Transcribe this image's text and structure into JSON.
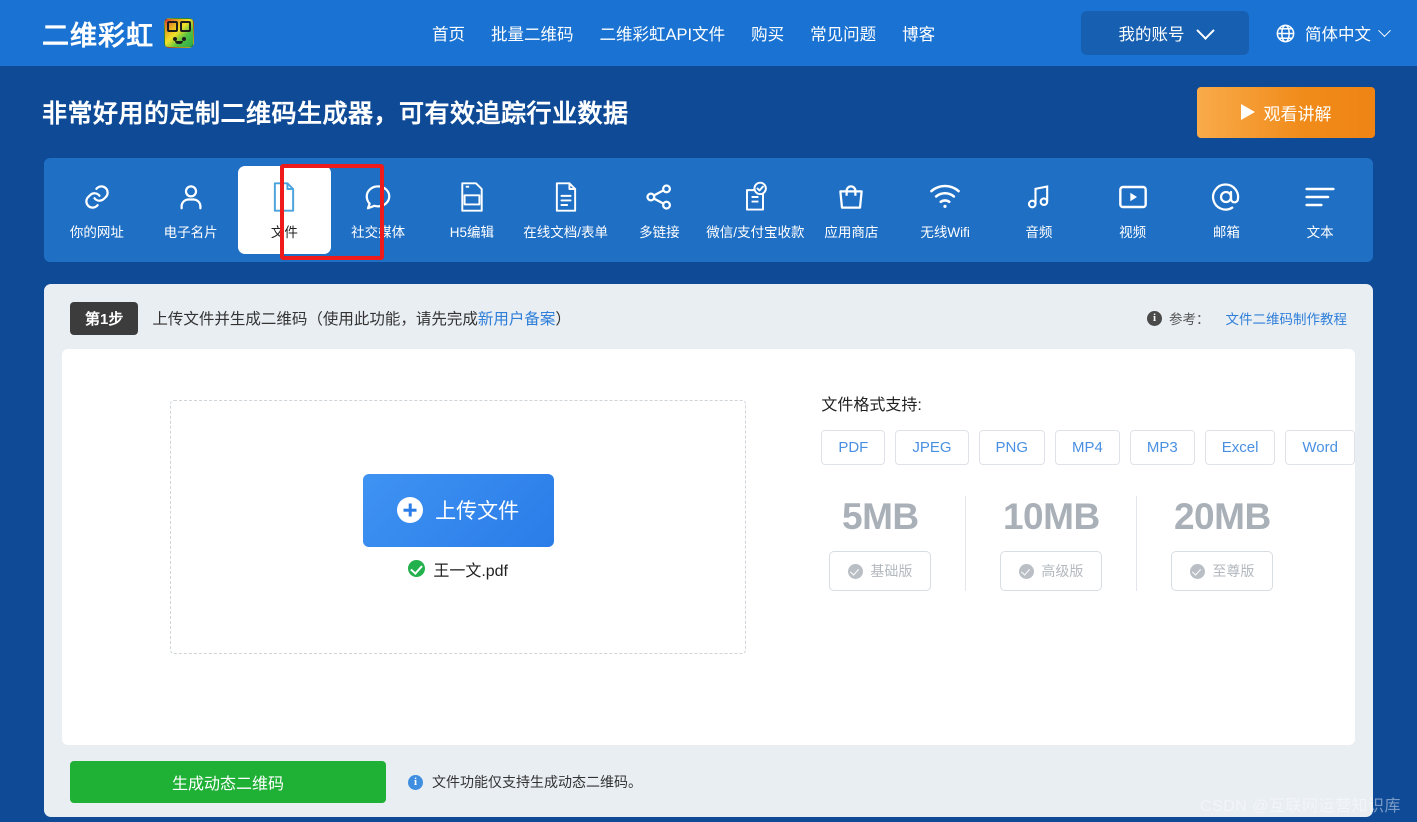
{
  "header": {
    "brand": "二维彩虹",
    "logo_icon": "rainbow-qr-bear-logo",
    "nav": [
      {
        "label": "首页"
      },
      {
        "label": "批量二维码"
      },
      {
        "label": "二维彩虹API文件"
      },
      {
        "label": "购买"
      },
      {
        "label": "常见问题"
      },
      {
        "label": "博客"
      }
    ],
    "account_label": "我的账号",
    "account_chevron_icon": "chevron-down-icon",
    "language_label": "简体中文",
    "language_icon": "globe-icon",
    "language_chevron_icon": "chevron-down-icon"
  },
  "hero": {
    "title": "非常好用的定制二维码生成器，可有效追踪行业数据",
    "watch_button": "观看讲解",
    "watch_icon": "play-icon",
    "watch_color": "#f08b1a"
  },
  "tabs": {
    "items": [
      {
        "label": "你的网址",
        "icon": "link-icon",
        "active": false
      },
      {
        "label": "电子名片",
        "icon": "person-icon",
        "active": false
      },
      {
        "label": "文件",
        "icon": "document-icon",
        "active": true
      },
      {
        "label": "社交媒体",
        "icon": "chat-bubble-icon",
        "active": false
      },
      {
        "label": "H5编辑",
        "icon": "html-file-icon",
        "active": false
      },
      {
        "label": "在线文档/表单",
        "icon": "text-document-icon",
        "active": false
      },
      {
        "label": "多链接",
        "icon": "share-nodes-icon",
        "active": false
      },
      {
        "label": "微信/支付宝收款",
        "icon": "payment-check-icon",
        "active": false
      },
      {
        "label": "应用商店",
        "icon": "shopping-bag-icon",
        "active": false
      },
      {
        "label": "无线Wifi",
        "icon": "wifi-icon",
        "active": false
      },
      {
        "label": "音频",
        "icon": "music-note-icon",
        "active": false
      },
      {
        "label": "视频",
        "icon": "video-play-icon",
        "active": false
      },
      {
        "label": "邮箱",
        "icon": "at-sign-icon",
        "active": false
      },
      {
        "label": "文本",
        "icon": "text-lines-icon",
        "active": false
      }
    ],
    "highlight_color": "#ef1b1b",
    "active_index": 2
  },
  "step": {
    "badge": "第1步",
    "text_before": "上传文件并生成二维码（使用此功能，请先完成",
    "link": "新用户备案",
    "text_after": "）",
    "ref_icon": "info-icon",
    "ref_label": "参考：",
    "ref_link": "文件二维码制作教程"
  },
  "upload": {
    "button_label": "上传文件",
    "plus_icon": "plus-circle-icon",
    "filename": "王一文.pdf",
    "file_status_icon": "check-circle-icon"
  },
  "formats": {
    "title": "文件格式支持:",
    "chips": [
      "PDF",
      "JPEG",
      "PNG",
      "MP4",
      "MP3",
      "Excel",
      "Word"
    ]
  },
  "tiers": [
    {
      "size": "5MB",
      "plan": "基础版",
      "icon": "check-circle-icon"
    },
    {
      "size": "10MB",
      "plan": "高级版",
      "icon": "check-circle-icon"
    },
    {
      "size": "20MB",
      "plan": "至尊版",
      "icon": "check-circle-icon"
    }
  ],
  "footer": {
    "generate_button": "生成动态二维码",
    "generate_color": "#1fb036",
    "note_icon": "info-icon",
    "note": "文件功能仅支持生成动态二维码。"
  },
  "watermark": "CSDN @互联网运营知识库"
}
